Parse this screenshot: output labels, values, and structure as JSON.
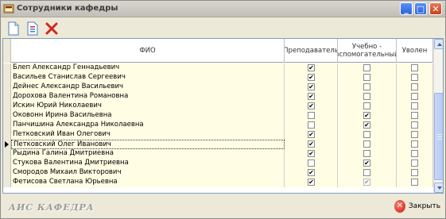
{
  "window": {
    "title": "Сотрудники кафедры",
    "controls": {
      "minimize": "_",
      "maximize": "□",
      "close": "✕"
    }
  },
  "toolbar": {
    "buttons": [
      {
        "icon": "new-document-icon"
      },
      {
        "icon": "edit-document-icon"
      },
      {
        "icon": "delete-x-icon"
      }
    ]
  },
  "table": {
    "columns": [
      "ФИО",
      "Преподаватель",
      "Учебно - вспомогательный",
      "Уволен"
    ],
    "rows": [
      {
        "fio": "Блеп Александр Геннадьевич",
        "teacher": true,
        "assistant": false,
        "fired": false
      },
      {
        "fio": "Васильев Станислав Сергеевич",
        "teacher": true,
        "assistant": false,
        "fired": false
      },
      {
        "fio": "Дейнес Александр Васильевич",
        "teacher": true,
        "assistant": false,
        "fired": false
      },
      {
        "fio": "Дорохова Валентина Романовна",
        "teacher": true,
        "assistant": false,
        "fired": false
      },
      {
        "fio": "Искин Юрий Николаевич",
        "teacher": true,
        "assistant": false,
        "fired": false
      },
      {
        "fio": "Оковонн Ирина Васильевна",
        "teacher": false,
        "assistant": true,
        "fired": false
      },
      {
        "fio": "Панчишина Александра Николаевна",
        "teacher": false,
        "assistant": true,
        "fired": false
      },
      {
        "fio": "Петковский Иван Олегович",
        "teacher": true,
        "assistant": false,
        "fired": false
      },
      {
        "fio": "Петковский Олег Иванович",
        "teacher": true,
        "assistant": false,
        "fired": false,
        "current": true
      },
      {
        "fio": "Рыдина Галина Дмитриевна",
        "teacher": true,
        "assistant": false,
        "fired": false
      },
      {
        "fio": "Стукова Валентина Дмитриевна",
        "teacher": false,
        "assistant": true,
        "fired": false
      },
      {
        "fio": "Смородов Михаил Викторович",
        "teacher": true,
        "assistant": false,
        "fired": false
      },
      {
        "fio": "Фетисова Светлана Юрьевна",
        "teacher": true,
        "assistant": true,
        "fired": false,
        "disabled_assistant": true
      }
    ]
  },
  "footer": {
    "brand": "АИС КАФЕДРА",
    "close_label": "Закрыть"
  },
  "colors": {
    "grid_bg": "#fffde4",
    "title_bar": "#c8c6bd",
    "close_red": "#c91d0f"
  }
}
